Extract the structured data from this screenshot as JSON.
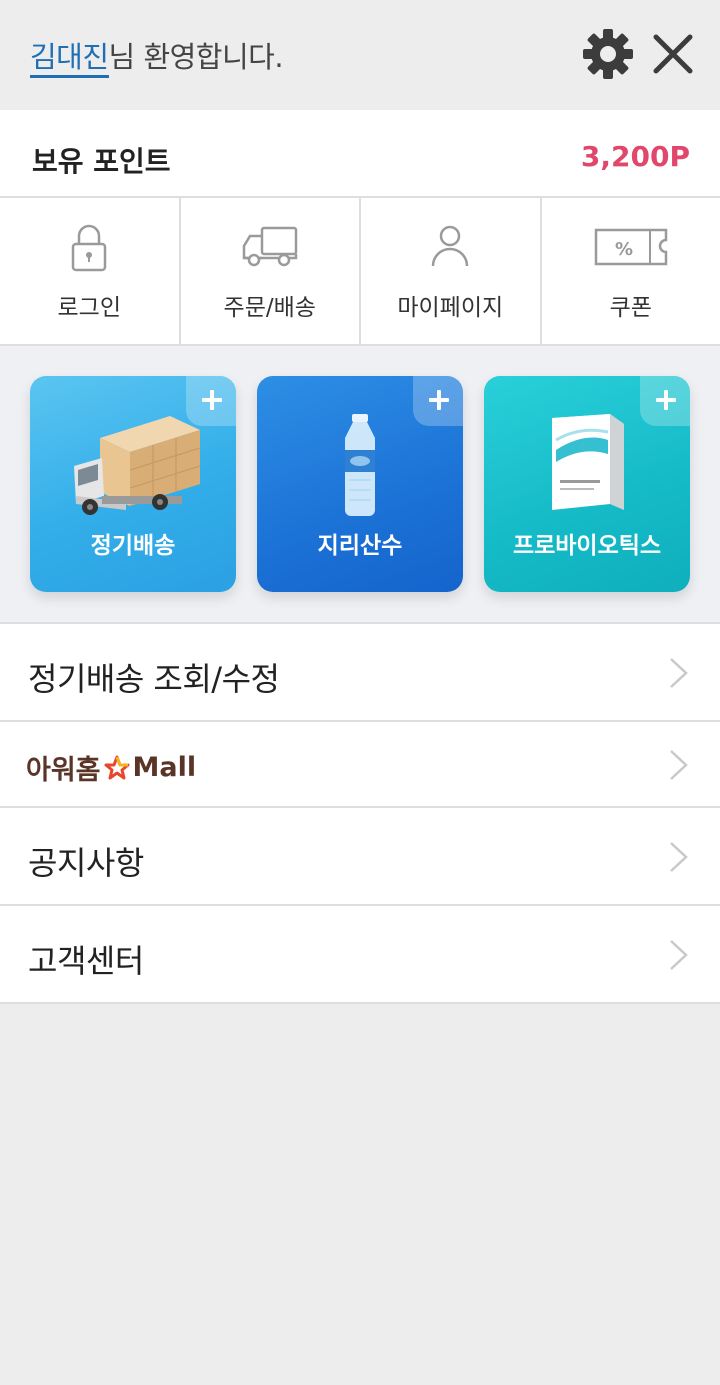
{
  "header": {
    "user_name": "김대진",
    "welcome_suffix": "님 환영합니다."
  },
  "points": {
    "label": "보유 포인트",
    "value": "3,200P"
  },
  "quick_menu": [
    {
      "label": "로그인",
      "icon": "lock-icon"
    },
    {
      "label": "주문/배송",
      "icon": "truck-icon"
    },
    {
      "label": "마이페이지",
      "icon": "person-icon"
    },
    {
      "label": "쿠폰",
      "icon": "coupon-icon"
    }
  ],
  "cards": [
    {
      "label": "정기배송",
      "image": "delivery-truck-image"
    },
    {
      "label": "지리산수",
      "image": "water-bottle-image"
    },
    {
      "label": "프로바이오틱스",
      "image": "probiotics-box-image"
    }
  ],
  "menu": {
    "items": [
      {
        "label": "정기배송 조회/수정"
      },
      {
        "label": "아워홈",
        "label_en": "Mall"
      },
      {
        "label": "공지사항"
      },
      {
        "label": "고객센터"
      }
    ]
  },
  "colors": {
    "accent_blue": "#1f6fb4",
    "points_red": "#e0476b",
    "background": "#ededee"
  }
}
